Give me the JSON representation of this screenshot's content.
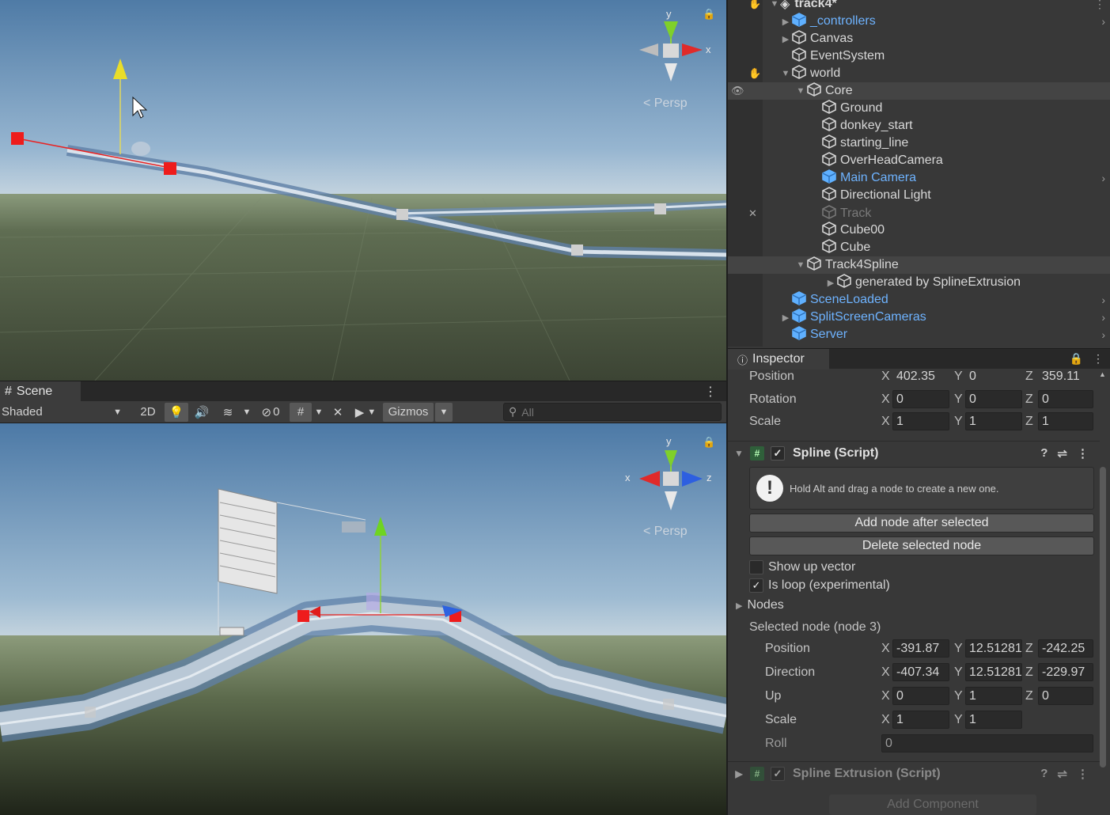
{
  "scene_top": {
    "persp_label": "< Persp",
    "gizmo_y": "y",
    "gizmo_x": "x"
  },
  "scene_panel": {
    "tab_label": "Scene",
    "shading_mode": "Shaded",
    "btn_2d": "2D",
    "hidden_count": "0",
    "gizmos_label": "Gizmos",
    "search_placeholder": "All",
    "persp_label": "< Persp",
    "gizmo_y": "y",
    "gizmo_x": "x",
    "gizmo_z": "z"
  },
  "hierarchy": {
    "scene_name": "track4*",
    "items": [
      {
        "label": "_controllers",
        "style": "prefab"
      },
      {
        "label": "Canvas",
        "style": "normal"
      },
      {
        "label": "EventSystem",
        "style": "normal"
      },
      {
        "label": "world",
        "style": "normal"
      },
      {
        "label": "Core",
        "style": "normal"
      },
      {
        "label": "Ground",
        "style": "normal"
      },
      {
        "label": "donkey_start",
        "style": "normal"
      },
      {
        "label": "starting_line",
        "style": "normal"
      },
      {
        "label": "OverHeadCamera",
        "style": "normal"
      },
      {
        "label": "Main Camera",
        "style": "prefab"
      },
      {
        "label": "Directional Light",
        "style": "normal"
      },
      {
        "label": "Track",
        "style": "dim"
      },
      {
        "label": "Cube00",
        "style": "normal"
      },
      {
        "label": "Cube",
        "style": "normal"
      },
      {
        "label": "Track4Spline",
        "style": "normal"
      },
      {
        "label": "generated by SplineExtrusion",
        "style": "normal"
      },
      {
        "label": "SceneLoaded",
        "style": "prefab"
      },
      {
        "label": "SplitScreenCameras",
        "style": "prefab"
      },
      {
        "label": "Server",
        "style": "prefab"
      }
    ]
  },
  "inspector": {
    "tab_label": "Inspector",
    "transform": {
      "position_label": "Position",
      "position": {
        "x": "402.35",
        "y": "0",
        "z": "359.11"
      },
      "rotation_label": "Rotation",
      "rotation": {
        "x": "0",
        "y": "0",
        "z": "0"
      },
      "scale_label": "Scale",
      "scale": {
        "x": "1",
        "y": "1",
        "z": "1"
      }
    },
    "axis": {
      "x": "X",
      "y": "Y",
      "z": "Z"
    },
    "spline": {
      "title": "Spline (Script)",
      "help_text": "Hold Alt and drag a node to create a new one.",
      "add_node_btn": "Add node after selected",
      "delete_node_btn": "Delete selected node",
      "show_up_vector_label": "Show up vector",
      "show_up_vector": false,
      "is_loop_label": "Is loop (experimental)",
      "is_loop": true,
      "nodes_label": "Nodes",
      "selected_node_label": "Selected node (node 3)",
      "node_position_label": "Position",
      "node_position": {
        "x": "-391.87",
        "y": "12.51281",
        "z": "-242.25"
      },
      "direction_label": "Direction",
      "direction": {
        "x": "-407.34",
        "y": "12.51281",
        "z": "-229.97"
      },
      "up_label": "Up",
      "up": {
        "x": "0",
        "y": "1",
        "z": "0"
      },
      "node_scale_label": "Scale",
      "node_scale": {
        "x": "1",
        "y": "1"
      },
      "roll_label": "Roll",
      "roll": "0"
    },
    "extrusion": {
      "title": "Spline Extrusion (Script)"
    },
    "add_component": "Add Component"
  },
  "colors": {
    "prefab_blue": "#6eb3ff",
    "panel_bg": "#383838",
    "selection_handle": "#e81d1d"
  }
}
